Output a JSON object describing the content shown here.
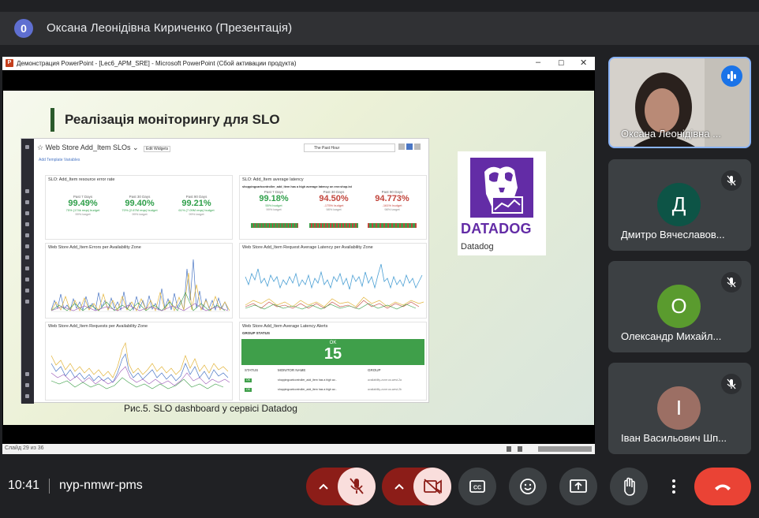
{
  "meeting": {
    "presenter_badge": "0",
    "presenter_title": "Оксана Леонідівна Кириченко (Презентація)",
    "time": "10:41",
    "code": "nyp-nmwr-pms"
  },
  "ppt_window": {
    "app_icon": "P",
    "title": "Демонстрация PowerPoint - [Lec6_APM_SRE] - Microsoft PowerPoint (Сбой активации продукта)",
    "minimize": "–",
    "maximize": "☐",
    "close": "✕",
    "status": "Слайд 29 из 36"
  },
  "slide": {
    "title": "Реалізація моніторингу для SLO",
    "caption": "Рис.5. SLO dashboard у сервісі Datadog",
    "logo_word": "DATADOG",
    "logo_caption": "Datadog"
  },
  "dashboard": {
    "title": "☆ Web Store Add_Item SLOs ⌄",
    "edit_widgets": "Edit Widgets",
    "template_vars": "Add Template Variables",
    "time_range": "The Past Hour",
    "panels": {
      "p1_title": "SLO: Add_Item resource error rate",
      "p2_title": "SLO: Add_Item average latency",
      "p2_sub": "shoppingcartcontroller_add_item has a high average latency on env:shop.ist",
      "p3_title": "Web Store Add_Item Errors per Availability Zone",
      "p4_title": "Web Store Add_Item Request Average Latency per Availability Zone",
      "p5_title": "Web Store Add_Item Requests per Availability Zone",
      "p6_title": "Web Store Add_Item Average Latency Alerts",
      "group_status": "GROUP STATUS",
      "ok_label": "OK",
      "ok_count": "15",
      "col_status": "STATUS",
      "col_monitor": "MONITOR NAME",
      "col_group": "GROUP"
    },
    "slo_error": [
      {
        "period": "Past 7 Days",
        "value": "99.49%",
        "budget": "75% (174k reqs) budget",
        "target": "99% target"
      },
      {
        "period": "Past 30 Days",
        "value": "99.40%",
        "budget": "70% (2.67M reqs) budget",
        "target": "99% target"
      },
      {
        "period": "Past 90 Days",
        "value": "99.21%",
        "budget": "61% (7.09M reqs) budget",
        "target": "99% target"
      }
    ],
    "slo_latency": [
      {
        "period": "Past 7 Days",
        "value": "99.18%",
        "budget": "55% budget",
        "target": "99% target"
      },
      {
        "period": "Past 30 Days",
        "value": "94.50%",
        "budget": "-175% budget",
        "target": "98% target"
      },
      {
        "period": "Past 90 Days",
        "value": "94.773%",
        "budget": "-161% budget",
        "target": "98% target"
      }
    ],
    "alert_rows": [
      {
        "status": "OK",
        "monitor": "shoppingcartcontroller_add_item has a high av...",
        "group": "availability-zone:us-west-2a"
      },
      {
        "status": "OK",
        "monitor": "shoppingcartcontroller_add_item has a high av...",
        "group": "availability-zone:us-west-2b"
      }
    ]
  },
  "participants": [
    {
      "name": "Оксана Леонідівна ...",
      "initial": "",
      "color": "#c7c3bd",
      "speaking": true
    },
    {
      "name": "Дмитро Вячеславов...",
      "initial": "Д",
      "color": "#0d5446",
      "muted": true
    },
    {
      "name": "Олександр Михайл...",
      "initial": "О",
      "color": "#5a9b2e",
      "muted": true
    },
    {
      "name": "Іван Васильович Шп...",
      "initial": "І",
      "color": "#9c6f64",
      "muted": true
    }
  ],
  "controls": {
    "mic_state": "off",
    "camera_state": "off",
    "accent_red": "#ea4335",
    "muted_bg": "#f9dedc",
    "dark_red": "#8c1d18"
  }
}
